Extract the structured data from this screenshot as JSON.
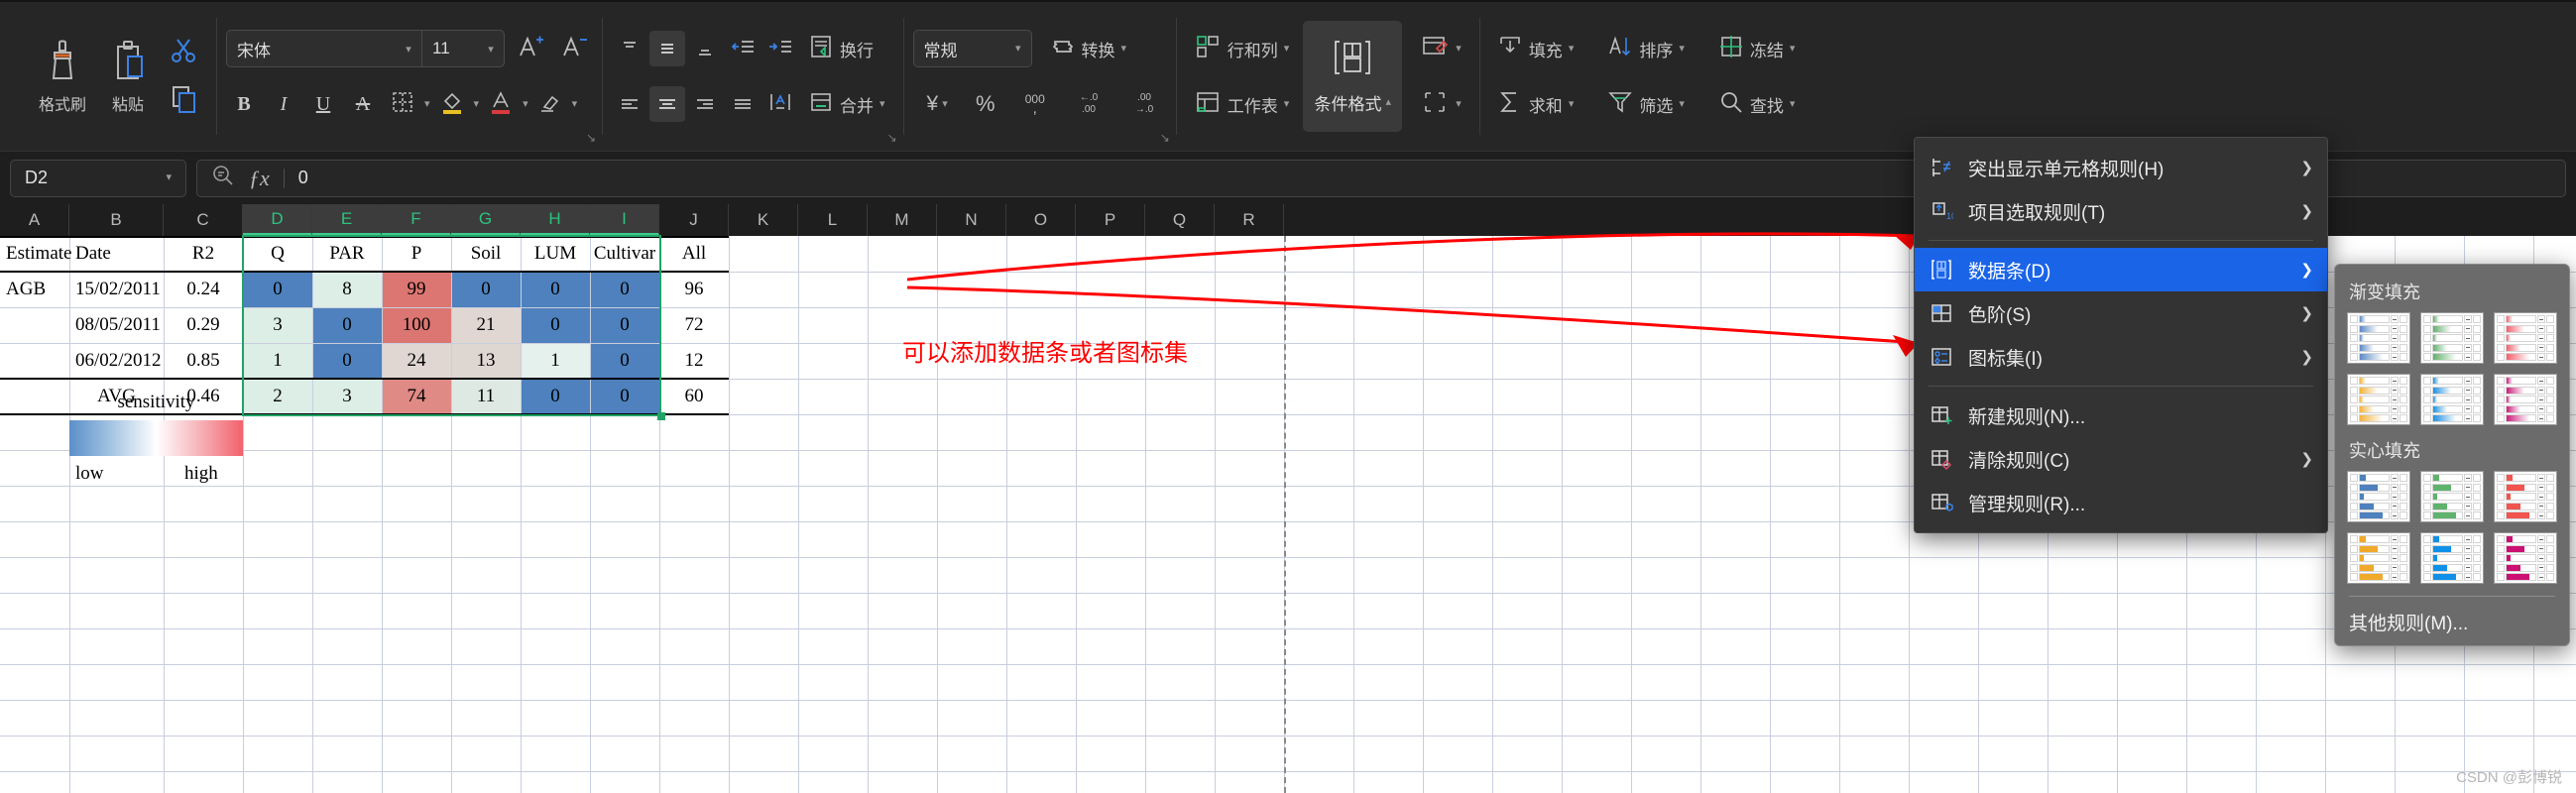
{
  "ribbon": {
    "clipboard": [
      {
        "label": "格式刷",
        "icon": "format-painter-icon"
      },
      {
        "label": "粘贴",
        "icon": "paste-icon"
      },
      {
        "label": "",
        "icon": "cut-icon"
      },
      {
        "label": "",
        "icon": "copy-icon"
      }
    ],
    "font": {
      "family_value": "宋体",
      "size_value": "11",
      "grow_icon": "increase-font-size-icon",
      "shrink_icon": "decrease-font-size-icon",
      "bold": "B",
      "italic": "I",
      "underline": "U",
      "strikethrough": "A",
      "border_icon": "borders-icon",
      "fill_icon": "fill-color-icon",
      "font_color_icon": "font-color-icon",
      "clear_icon": "clear-format-icon"
    },
    "alignment": {
      "wrap_label": "换行",
      "merge_label": "合并",
      "indent_decrease_icon": "decrease-indent-icon",
      "indent_increase_icon": "increase-indent-icon",
      "orientation_icon": "text-orientation-icon"
    },
    "number": {
      "format_value": "常规",
      "currency_icon": "currency-icon",
      "percent_icon": "percent-icon",
      "comma_icon": "comma-style-icon",
      "dec_increase_icon": "increase-decimal-icon",
      "dec_decrease_icon": "decrease-decimal-icon",
      "convert_label": "转换"
    },
    "cells": {
      "rows_cols_label": "行和列",
      "worksheet_label": "工作表",
      "cond_format_label": "条件格式",
      "table_style_icon": "table-style-icon",
      "cell_style_icon": "cell-style-icon"
    },
    "editing": [
      {
        "label": "填充",
        "icon": "fill-down-icon"
      },
      {
        "label": "排序",
        "icon": "sort-icon"
      },
      {
        "label": "冻结",
        "icon": "freeze-panes-icon"
      },
      {
        "label": "求和",
        "icon": "autosum-icon"
      },
      {
        "label": "筛选",
        "icon": "filter-icon"
      },
      {
        "label": "查找",
        "icon": "search-icon"
      }
    ]
  },
  "formula_bar": {
    "name_box_value": "D2",
    "formula_value": "0",
    "insert_function_icon": "insert-function-icon",
    "search_icon": "formula-search-icon"
  },
  "sheet": {
    "columns": [
      "A",
      "B",
      "C",
      "D",
      "E",
      "F",
      "G",
      "H",
      "I",
      "J",
      "K",
      "L",
      "M",
      "N",
      "O",
      "P",
      "Q",
      "R"
    ],
    "selected_columns": [
      "D",
      "E",
      "F",
      "G",
      "H",
      "I"
    ],
    "header_row": [
      "Estimate",
      "Date",
      "R2",
      "Q",
      "PAR",
      "P",
      "Soil",
      "LUM",
      "Cultivar",
      "All"
    ],
    "rows": [
      {
        "estimate": "AGB",
        "date": "15/02/2011",
        "r2": "0.24",
        "q": "0",
        "par": "8",
        "p": "99",
        "soil": "0",
        "lum": "0",
        "cultivar": "0",
        "all": "96"
      },
      {
        "estimate": "",
        "date": "08/05/2011",
        "r2": "0.29",
        "q": "3",
        "par": "0",
        "p": "100",
        "soil": "21",
        "lum": "0",
        "cultivar": "0",
        "all": "72"
      },
      {
        "estimate": "",
        "date": "06/02/2012",
        "r2": "0.85",
        "q": "1",
        "par": "0",
        "p": "24",
        "soil": "13",
        "lum": "1",
        "cultivar": "0",
        "all": "12"
      },
      {
        "estimate": "",
        "date": "AVG",
        "r2": "0.46",
        "q": "2",
        "par": "3",
        "p": "74",
        "soil": "11",
        "lum": "0",
        "cultivar": "0",
        "all": "60"
      }
    ],
    "legend": {
      "title": "sensitivity",
      "low_label": "low",
      "high_label": "high",
      "low_color": "#5b8fc9",
      "high_color": "#f2616b"
    },
    "annotation": "可以添加数据条或者图标集",
    "annotation_color": "#ff0000"
  },
  "menu": {
    "items": [
      {
        "label": "突出显示单元格规则(H)",
        "icon": "highlight-cell-rules-icon",
        "has_submenu": true,
        "selected": false
      },
      {
        "label": "项目选取规则(T)",
        "icon": "top-bottom-rules-icon",
        "has_submenu": true,
        "selected": false
      },
      {
        "separator": true
      },
      {
        "label": "数据条(D)",
        "icon": "data-bars-icon",
        "has_submenu": true,
        "selected": true
      },
      {
        "label": "色阶(S)",
        "icon": "color-scales-icon",
        "has_submenu": true,
        "selected": false
      },
      {
        "label": "图标集(I)",
        "icon": "icon-sets-icon",
        "has_submenu": true,
        "selected": false
      },
      {
        "separator": true
      },
      {
        "label": "新建规则(N)...",
        "icon": "new-rule-icon",
        "has_submenu": false,
        "selected": false
      },
      {
        "label": "清除规则(C)",
        "icon": "clear-rules-icon",
        "has_submenu": true,
        "selected": false
      },
      {
        "label": "管理规则(R)...",
        "icon": "manage-rules-icon",
        "has_submenu": false,
        "selected": false
      }
    ]
  },
  "submenu": {
    "gradient_heading": "渐变填充",
    "solid_heading": "实心填充",
    "more_label": "其他规则(M)...",
    "gradient_colors": [
      "#5b8ac5",
      "#63b06d",
      "#f4606c",
      "#f2b33d",
      "#1e90e0",
      "#cc1d7a"
    ],
    "solid_colors": [
      "#4e81bd",
      "#5fb36c",
      "#f2544f",
      "#f0a92b",
      "#1190e8",
      "#cc0f72"
    ],
    "bar_widths": [
      22,
      62,
      14,
      48,
      80
    ]
  },
  "watermark": "CSDN @彭博锐",
  "colors": {
    "accent_green": "#21a366",
    "menu_highlight": "#1a64e8",
    "heat_blue": "#4e81bd",
    "heat_red": "#dc7672",
    "heat_mint": "#dceee6",
    "heat_beige": "#e0d7d2"
  }
}
